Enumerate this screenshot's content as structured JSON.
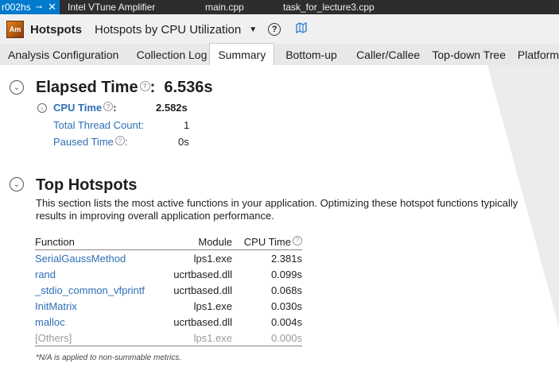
{
  "doc_tabs": {
    "active": {
      "label": "r002hs",
      "pin": "⊸",
      "close": "✕"
    },
    "tabs": [
      "Intel VTune Amplifier",
      "main.cpp",
      "task_for_lecture3.cpp"
    ]
  },
  "titlebar": {
    "app_icon_text": "Am",
    "title": "Hotspots",
    "viewpoint": "Hotspots by CPU Utilization",
    "dropdown": "▼",
    "help": "?"
  },
  "tabs": [
    "Analysis Configuration",
    "Collection Log",
    "Summary",
    "Bottom-up",
    "Caller/Callee",
    "Top-down Tree",
    "Platform"
  ],
  "active_tab": "Summary",
  "elapsed": {
    "label": "Elapsed Time",
    "colon": ":",
    "value": "6.536s",
    "cpu_time_label": "CPU Time",
    "cpu_time_colon": ":",
    "cpu_time_value": "2.582s",
    "thread_count_label": "Total Thread Count:",
    "thread_count_value": "1",
    "paused_label": "Paused Time",
    "paused_colon": ":",
    "paused_value": "0s"
  },
  "top_hotspots": {
    "label": "Top Hotspots",
    "description": "This section lists the most active functions in your application. Optimizing these hotspot functions typically results in improving overall application performance.",
    "columns": {
      "function": "Function",
      "module": "Module",
      "cpu": "CPU Time"
    },
    "rows": [
      {
        "function": "SerialGaussMethod",
        "module": "lps1.exe",
        "cpu": "2.381s"
      },
      {
        "function": "rand",
        "module": "ucrtbased.dll",
        "cpu": "0.099s"
      },
      {
        "function": "_stdio_common_vfprintf",
        "module": "ucrtbased.dll",
        "cpu": "0.068s"
      },
      {
        "function": "InitMatrix",
        "module": "lps1.exe",
        "cpu": "0.030s"
      },
      {
        "function": "malloc",
        "module": "ucrtbased.dll",
        "cpu": "0.004s"
      },
      {
        "function": "[Others]",
        "module": "lps1.exe",
        "cpu": "0.000s"
      }
    ],
    "footnote": "*N/A is applied to non-summable metrics."
  },
  "colors": {
    "accent": "#007acc",
    "link": "#2d6fb5",
    "muted": "#9a9a9a"
  }
}
